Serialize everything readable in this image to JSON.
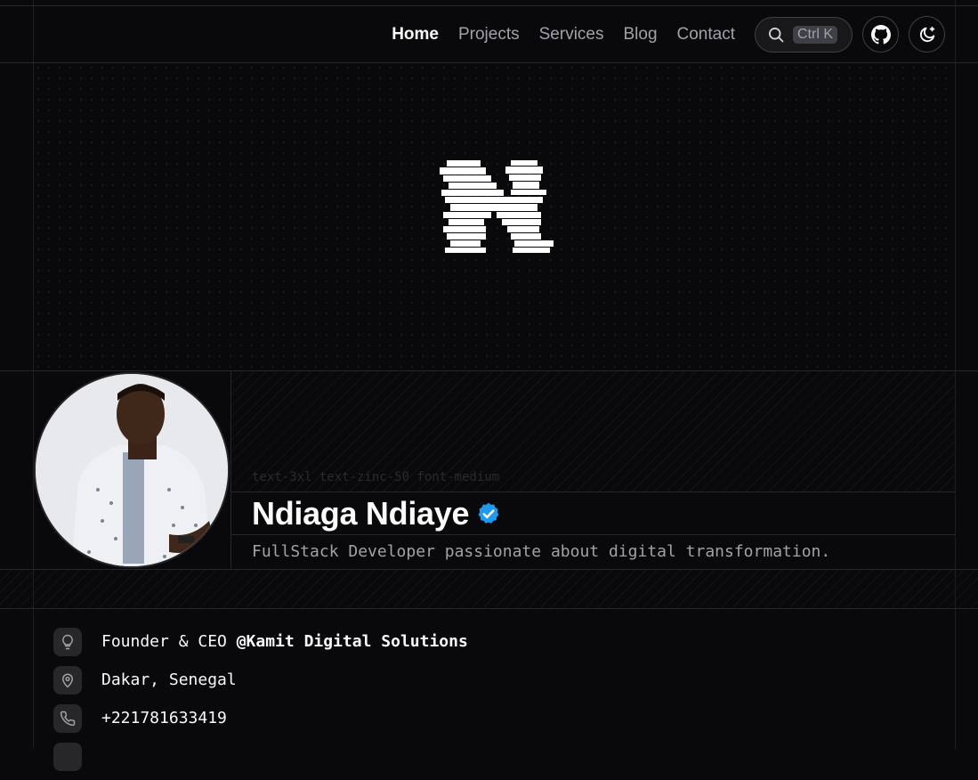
{
  "nav": {
    "links": [
      "Home",
      "Projects",
      "Services",
      "Blog",
      "Contact"
    ],
    "search_shortcut": "Ctrl K"
  },
  "icons": {
    "search": "search-icon",
    "github": "github-icon",
    "theme": "moon-icon",
    "logo": "glitch-n-logo",
    "verified": "verified-badge-icon",
    "role": "lightbulb-icon",
    "location": "map-pin-icon",
    "phone": "phone-icon"
  },
  "profile": {
    "code_hint": "text-3xl text-zinc-50 font-medium",
    "name": "Ndiaga Ndiaye",
    "tagline": "FullStack Developer passionate about digital transformation."
  },
  "info": {
    "role_prefix": "Founder & CEO ",
    "company": "@Kamit Digital Solutions",
    "location": "Dakar, Senegal",
    "phone": "+221781633419"
  },
  "colors": {
    "background": "#09090b",
    "border": "#27272a",
    "verified": "#1d9bf0",
    "text": "#fafafa",
    "muted": "#a1a1aa"
  }
}
